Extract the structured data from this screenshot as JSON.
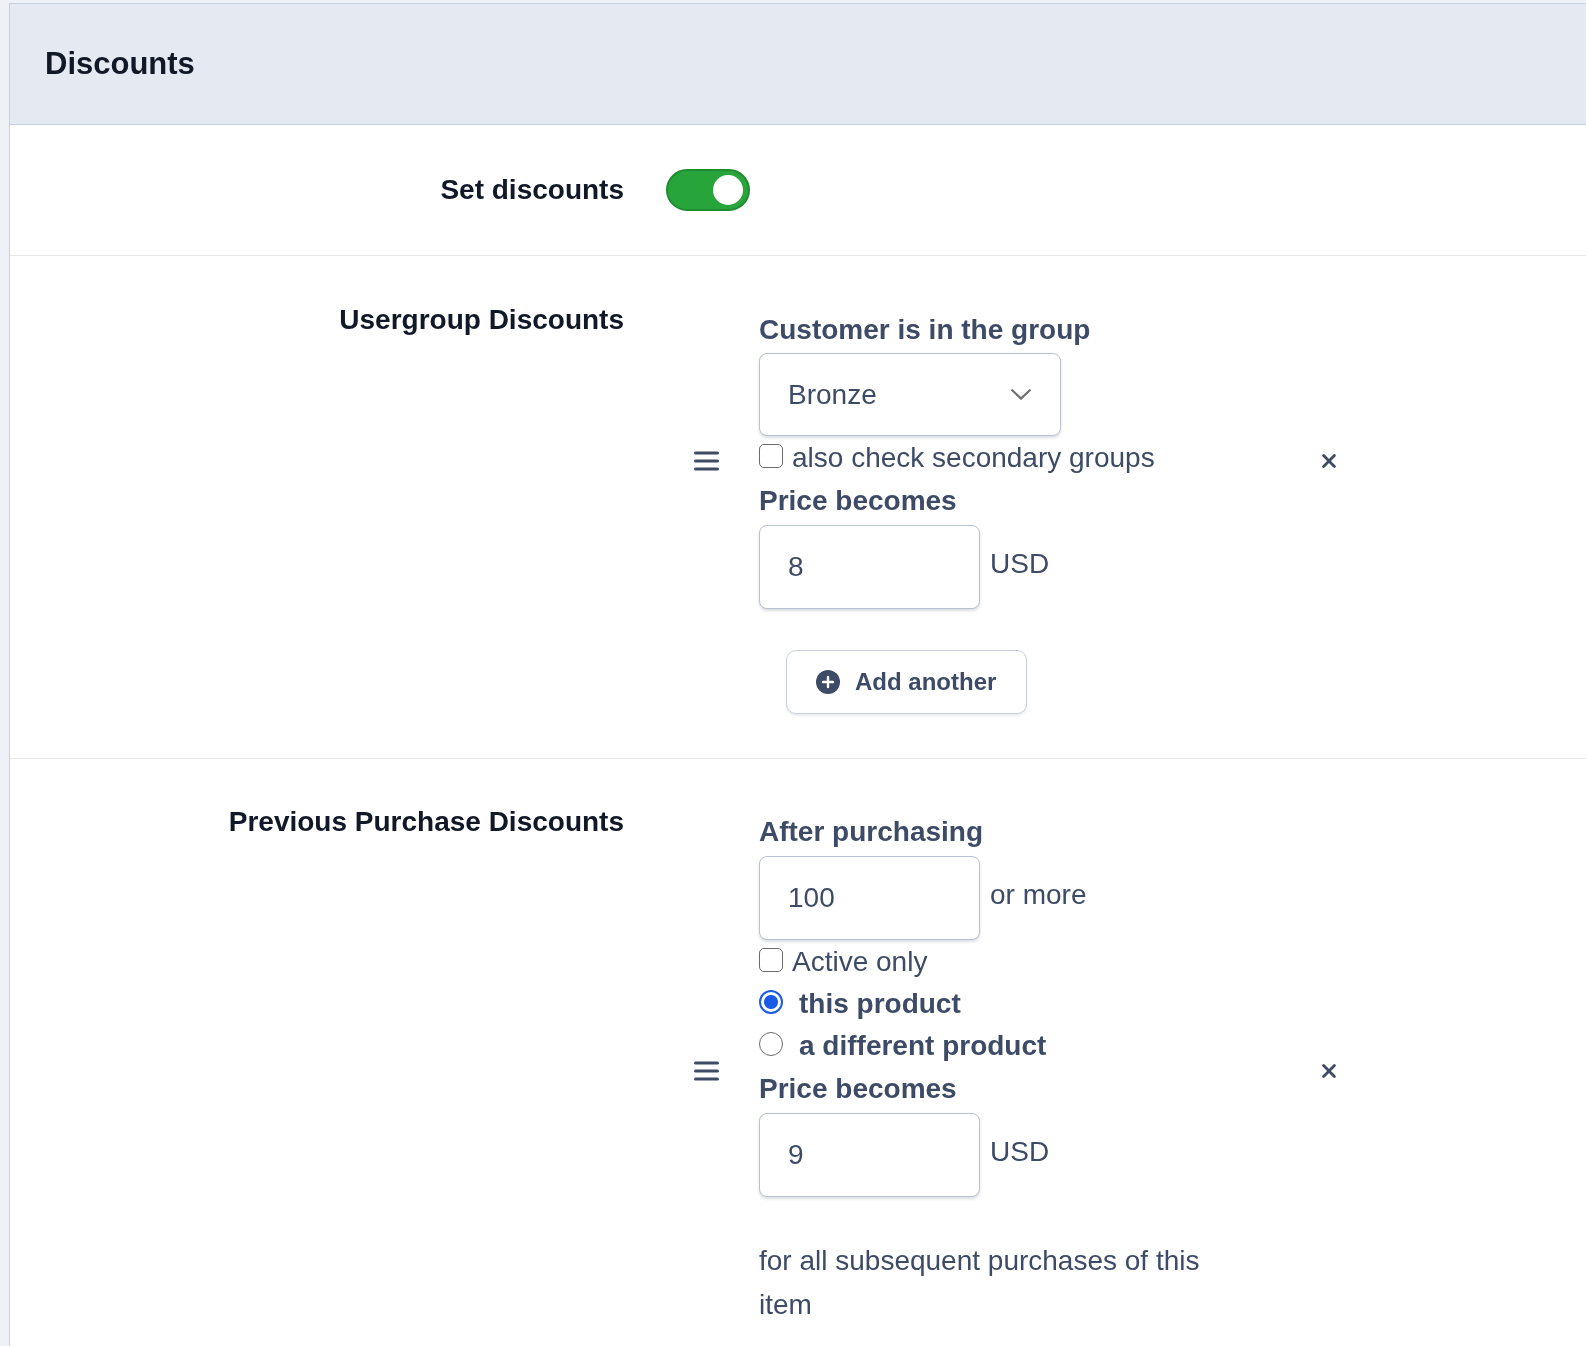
{
  "panel": {
    "title": "Discounts"
  },
  "set_discounts": {
    "label": "Set discounts",
    "on": true
  },
  "sections": [
    {
      "label": "Usergroup Discounts",
      "rules": [
        {
          "fields": [
            {
              "kind": "label",
              "text": "Customer is in the group"
            },
            {
              "kind": "select",
              "value": "Bronze"
            },
            {
              "kind": "checkbox",
              "label": "also check secondary groups",
              "checked": false
            },
            {
              "kind": "label",
              "text": "Price becomes"
            },
            {
              "kind": "input",
              "value": "8",
              "suffix": "USD"
            }
          ]
        }
      ],
      "add_button": "Add another"
    },
    {
      "label": "Previous Purchase Discounts",
      "rules": [
        {
          "fields": [
            {
              "kind": "label",
              "text": "After purchasing"
            },
            {
              "kind": "input",
              "value": "100",
              "suffix": "or more"
            },
            {
              "kind": "checkbox",
              "label": "Active only",
              "checked": false
            },
            {
              "kind": "radio",
              "label": "this product",
              "selected": true
            },
            {
              "kind": "radio",
              "label": "a different product",
              "selected": false
            },
            {
              "kind": "label",
              "text": "Price becomes"
            },
            {
              "kind": "input",
              "value": "9",
              "suffix": "USD"
            },
            {
              "kind": "note",
              "text": "for all subsequent purchases of this item"
            }
          ]
        }
      ]
    }
  ]
}
